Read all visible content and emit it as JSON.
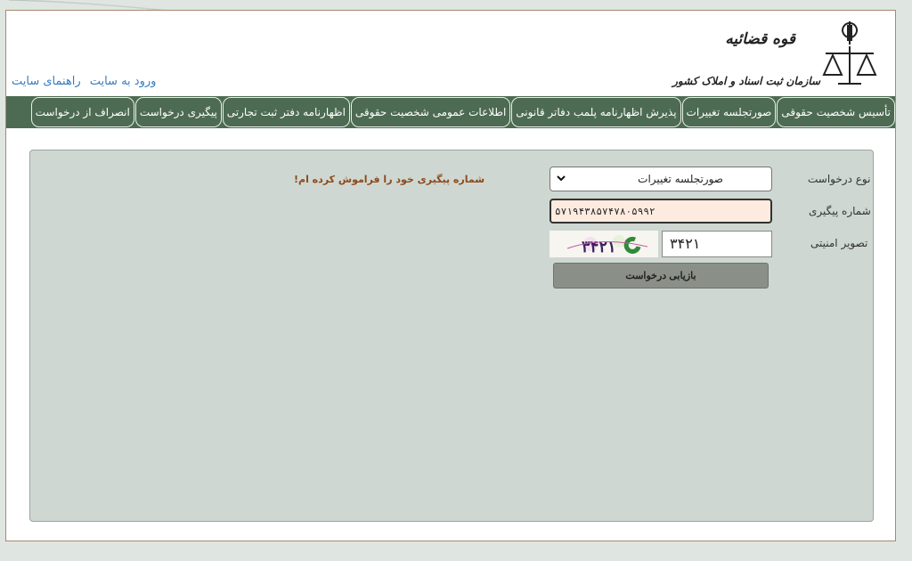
{
  "header": {
    "org_title": "قوه قضائیه",
    "org_subtitle": "سازمان ثبت اسناد و املاک کشور",
    "links": {
      "login": "ورود به سایت",
      "help": "راهنمای سایت"
    }
  },
  "nav": {
    "items": [
      "تأسیس شخصیت حقوقی",
      "صورتجلسه تغییرات",
      "پذیرش اظهارنامه پلمب دفاتر قانونی",
      "اطلاعات عمومی شخصیت حقوقی",
      "اظهارنامه دفتر ثبت تجارتی",
      "پیگیری درخواست",
      "انصراف از درخواست"
    ]
  },
  "form": {
    "request_type_label": "نوع درخواست",
    "request_type_value": "صورتجلسه تغییرات",
    "tracking_label": "شماره پیگیری",
    "tracking_value": "۵۷۱۹۴۳۸۵۷۴۷۸۰۵۹۹۲",
    "captcha_label": "تصویر امنیتی",
    "captcha_value": "۳۴۲۱",
    "captcha_image_text": "۳۴۲۱",
    "submit_label": "بازیابی درخواست",
    "forgot_link": "شماره پیگیری خود را فراموش کرده ام!"
  },
  "colors": {
    "nav_bg": "#4d6b52",
    "panel_bg": "#cfd7d2",
    "link": "#3a7bc0",
    "forgot": "#8b4a1b",
    "input_focus_bg": "#fdebe0"
  }
}
